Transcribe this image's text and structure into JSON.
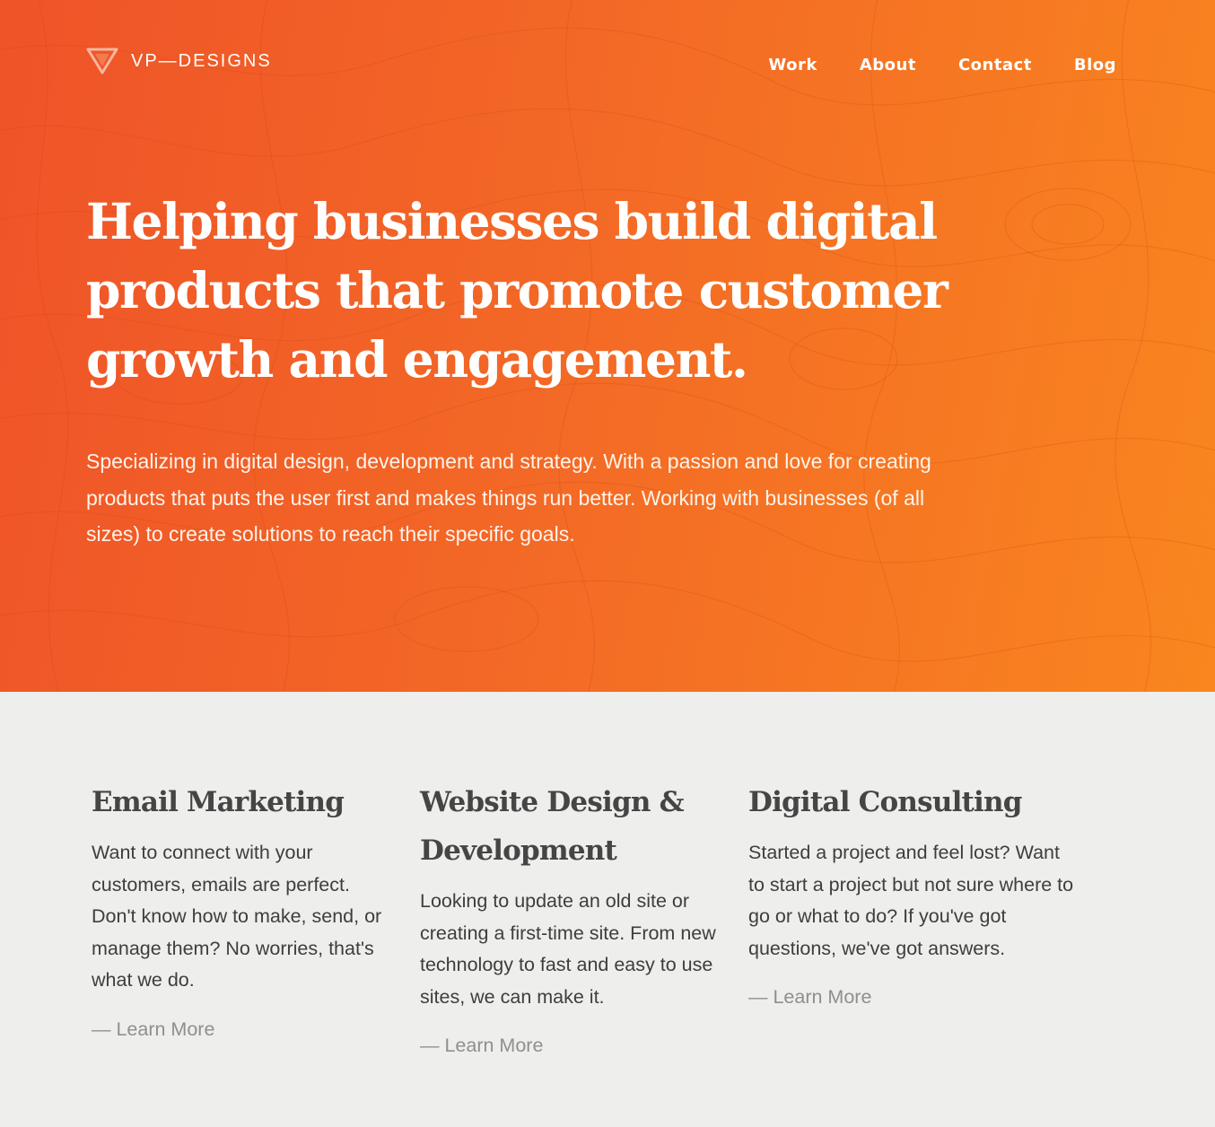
{
  "brand": {
    "logo_text": "VP—DESIGNS",
    "logo_icon": "triangle-logo-icon",
    "accent_start": "#ef5328",
    "accent_end": "#f9861f"
  },
  "nav": {
    "items": [
      "Work",
      "About",
      "Contact",
      "Blog"
    ]
  },
  "hero": {
    "headline": "Helping businesses build digital products that promote customer growth and engagement.",
    "intro": "Specializing in digital design, development and strategy. With a passion and love for creating products that puts the user first and makes things run better. Working with businesses (of all sizes) to create solutions to reach their specific goals."
  },
  "services": [
    {
      "title": "Email Marketing",
      "body": "Want to connect with your customers, emails are perfect. Don't know how to make, send, or manage them? No worries, that's what we do.",
      "link": "— Learn More"
    },
    {
      "title": "Website Design & Development",
      "body": "Looking to update an old site or creating a first-time site. From new technology to fast and easy to use sites, we can make it.",
      "link": "— Learn More"
    },
    {
      "title": "Digital Consulting",
      "body": "Started a project and feel lost? Want to start a project but not sure where to go or what to do? If you've got questions, we've got answers.",
      "link": "— Learn More"
    }
  ]
}
